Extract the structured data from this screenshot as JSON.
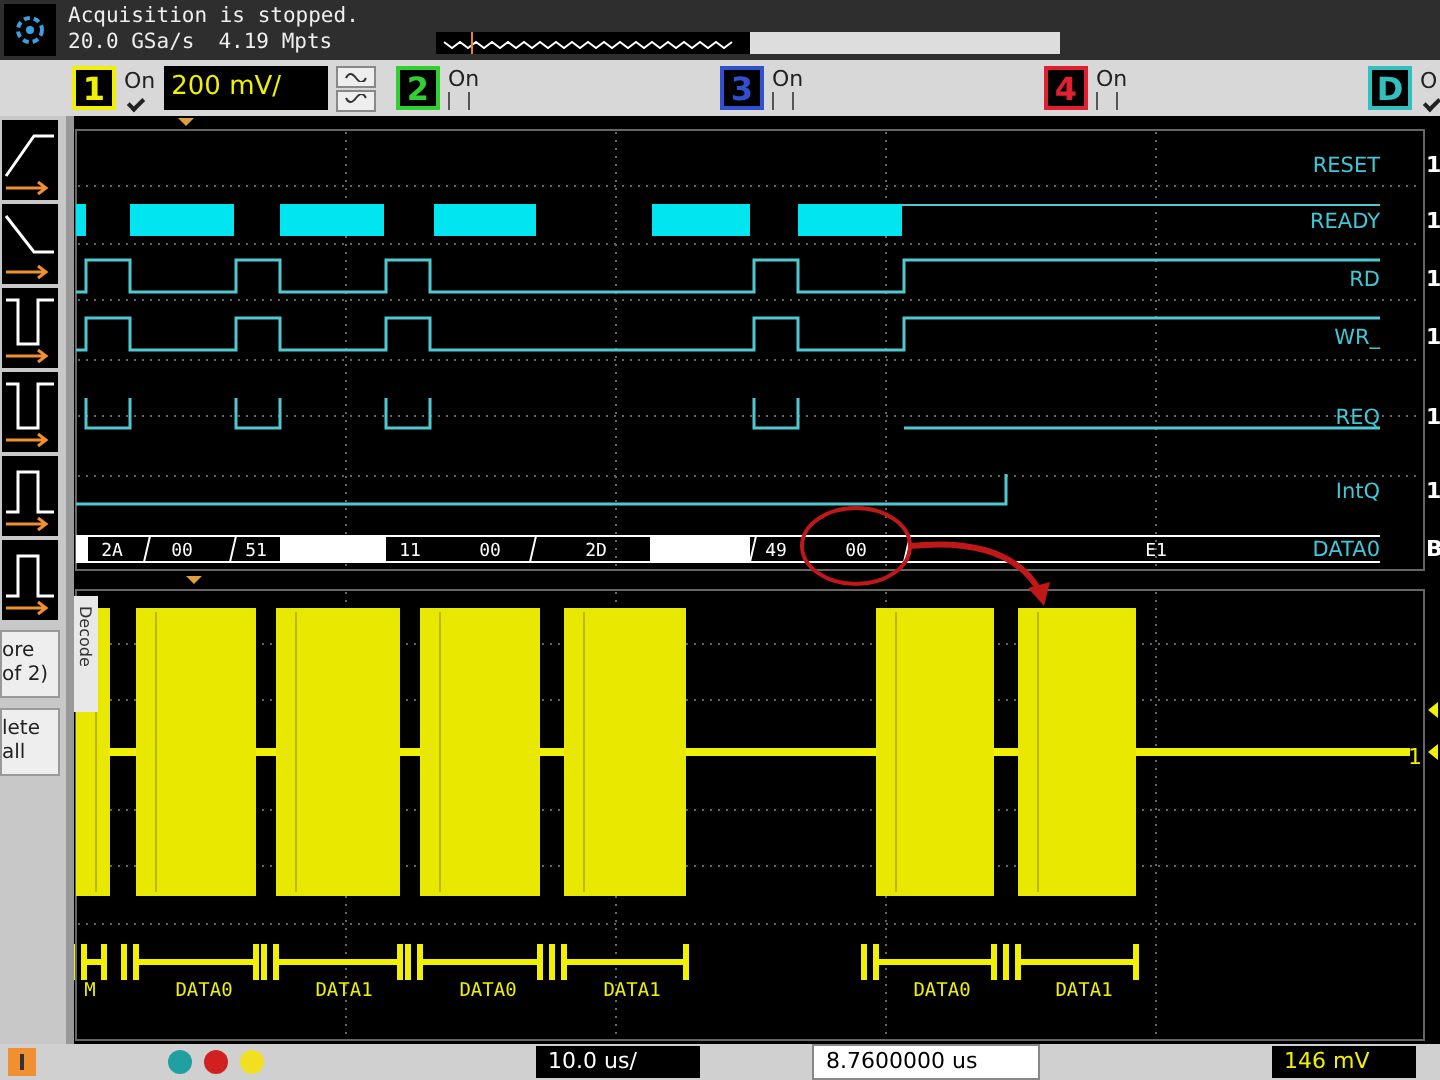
{
  "status": {
    "message": "Acquisition is stopped.",
    "sample_rate": "20.0 GSa/s",
    "memory": "4.19 Mpts"
  },
  "channels": [
    {
      "number": "1",
      "label": "On",
      "checked": true,
      "color": "#f0f000",
      "scale": "200 mV/"
    },
    {
      "number": "2",
      "label": "On",
      "checked": false,
      "color": "#30d030"
    },
    {
      "number": "3",
      "label": "On",
      "checked": false,
      "color": "#3050d0"
    },
    {
      "number": "4",
      "label": "On",
      "checked": false,
      "color": "#e02030"
    },
    {
      "number": "D",
      "label": "O",
      "checked": true,
      "color": "#30c0c0"
    }
  ],
  "side_buttons": [
    {
      "lines": [
        "ore",
        "of 2)"
      ]
    },
    {
      "lines": [
        "lete",
        "all"
      ]
    }
  ],
  "digital_channels": [
    {
      "name": "RESET",
      "marker": "1"
    },
    {
      "name": "READY",
      "marker": "1"
    },
    {
      "name": "RD",
      "marker": "1"
    },
    {
      "name": "WR_",
      "marker": "1"
    },
    {
      "name": "REQ",
      "marker": "1"
    },
    {
      "name": "IntQ",
      "marker": "1"
    },
    {
      "name": "DATA0",
      "marker": "B"
    }
  ],
  "bus_values": [
    "2A",
    "00",
    "51",
    "11",
    "00",
    "2D",
    "49",
    "00",
    "E1"
  ],
  "decode_tab": "Decode",
  "decode_labels": [
    "M",
    "DATA0",
    "DATA1",
    "DATA0",
    "DATA1",
    "DATA0",
    "DATA1"
  ],
  "ground_marker": "1",
  "bottom": {
    "timebase": "10.0 us/",
    "delay": "8.7600000 us",
    "trigger_level": "146 mV"
  }
}
